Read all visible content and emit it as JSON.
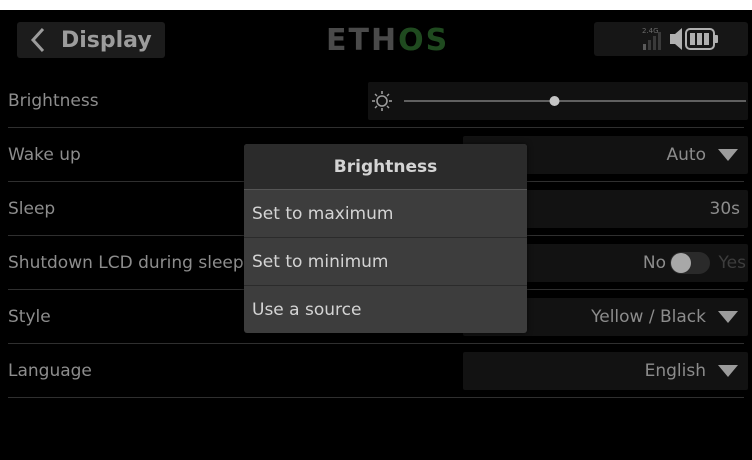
{
  "header": {
    "title": "Display",
    "logo": {
      "part1": "ETH",
      "part2": "OS"
    },
    "rf_band_label": "2.4G"
  },
  "settings": {
    "brightness": {
      "label": "Brightness",
      "level_fraction": 0.44
    },
    "wake_up": {
      "label": "Wake up",
      "value": "Auto"
    },
    "sleep": {
      "label": "Sleep",
      "value": "30s"
    },
    "shutdown_lcd": {
      "label": "Shutdown LCD during sleep",
      "off_label": "No",
      "on_label": "Yes",
      "state": "off"
    },
    "style": {
      "label": "Style",
      "value": "Yellow / Black"
    },
    "language": {
      "label": "Language",
      "value": "English"
    }
  },
  "popup": {
    "title": "Brightness",
    "items": [
      {
        "label": "Set to maximum"
      },
      {
        "label": "Set to minimum"
      },
      {
        "label": "Use a source"
      }
    ]
  },
  "colors": {
    "background": "#000000",
    "text": "#9a9a9a",
    "popup": "#3d3d3d",
    "logo_accent": "#1f4a1f"
  }
}
